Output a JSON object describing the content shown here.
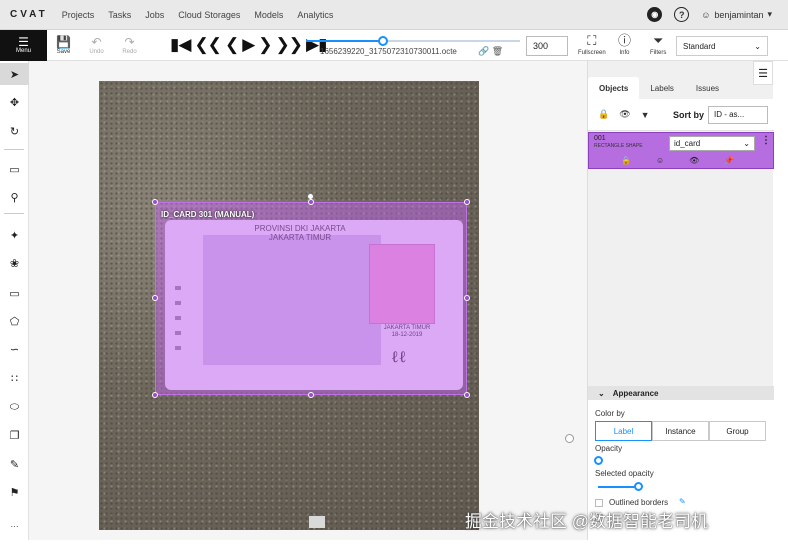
{
  "nav": {
    "logo": "CVAT",
    "links": [
      "Projects",
      "Tasks",
      "Jobs",
      "Cloud Storages",
      "Models",
      "Analytics"
    ],
    "help": "?",
    "user": "benjamintan"
  },
  "toolbar": {
    "menu_label": "Menu",
    "save_label": "Save",
    "undo_label": "Undo",
    "redo_label": "Redo",
    "filename": "1656239220_3175072310730011.octe",
    "frame_number": "300",
    "fullscreen_label": "Fullscreen",
    "info_label": "Info",
    "filters_label": "Filters",
    "view_mode": "Standard",
    "frame_progress": 0.36
  },
  "canvas": {
    "box_label": "ID_CARD 301 (MANUAL)",
    "card_title": "PROVINSI DKI JAKARTA\nJAKARTA TIMUR",
    "card_location": "JAKARTA TIMUR\n18-12-2019"
  },
  "sidebar": {
    "tabs": [
      "Objects",
      "Labels",
      "Issues"
    ],
    "active_tab": "Objects",
    "sort_label": "Sort by",
    "sort_value": "ID - as...",
    "object": {
      "id": "001",
      "type": "RECTANGLE SHAPE",
      "label": "id_card",
      "color": "#b66de0"
    },
    "appearance": {
      "title": "Appearance",
      "color_by_label": "Color by",
      "color_by_options": [
        "Label",
        "Instance",
        "Group"
      ],
      "color_by_selected": "Label",
      "opacity_label": "Opacity",
      "selected_opacity_label": "Selected opacity",
      "outlined_label": "Outlined borders",
      "opacity_value": 0.0,
      "selected_opacity_value": 0.4
    }
  },
  "watermark": "掘金技术社区 @数据智能老司机",
  "colors": {
    "accent": "#1890ff",
    "annotation": "#cc66ff",
    "dark": "#111111"
  }
}
